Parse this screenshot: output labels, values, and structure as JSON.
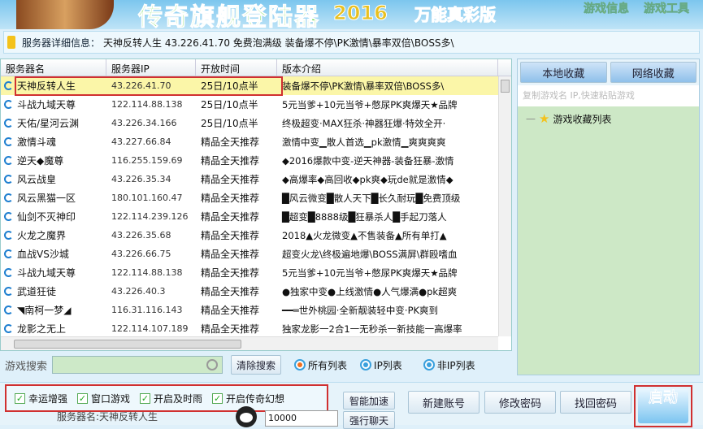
{
  "header": {
    "title": "传奇旗舰登陆器",
    "year": "2016",
    "edition": "万能真彩版",
    "links": [
      "游戏信息",
      "游戏工具"
    ]
  },
  "info": {
    "label": "服务器详细信息：",
    "value": "天神反转人生 43.226.41.70 免费泡满级 装备爆不停\\PK激情\\暴率双倍\\BOSS多\\"
  },
  "table": {
    "columns": [
      "服务器名",
      "服务器IP",
      "开放时间",
      "版本介绍"
    ],
    "rows": [
      {
        "name": "天神反转人生",
        "ip": "43.226.41.70",
        "time": "25日/10点半",
        "desc": "装备爆不停\\PK激情\\暴率双倍\\BOSS多\\",
        "selected": true
      },
      {
        "name": "斗战九域天尊",
        "ip": "122.114.88.138",
        "time": "25日/10点半",
        "desc": "5元当爹+10元当爷+憋尿PK爽爆天★品牌"
      },
      {
        "name": "天佑/星河云渊",
        "ip": "43.226.34.166",
        "time": "25日/10点半",
        "desc": "终极超变·MAX狂杀·神器狂爆·特效全开·"
      },
      {
        "name": "激情斗魂",
        "ip": "43.227.66.84",
        "time": "精品全天推荐",
        "desc": "激情中变▁散人首选▁pk激情▁爽爽爽爽"
      },
      {
        "name": "逆天◆魔尊",
        "ip": "116.255.159.69",
        "time": "精品全天推荐",
        "desc": "◆2016爆款中变-逆天神器-装备狂暴-激情"
      },
      {
        "name": "风云战皇",
        "ip": "43.226.35.34",
        "time": "精品全天推荐",
        "desc": "◆高爆率◆高回收◆pk爽◆玩de就是激情◆"
      },
      {
        "name": "风云黑猫一区",
        "ip": "180.101.160.47",
        "time": "精品全天推荐",
        "desc": "█风云微变█散人天下█长久耐玩█免费顶级"
      },
      {
        "name": "仙剑不灭神印",
        "ip": "122.114.239.126",
        "time": "精品全天推荐",
        "desc": "█超变█8888级█狂暴杀人█手起刀落人"
      },
      {
        "name": "火龙之魔界",
        "ip": "43.226.35.68",
        "time": "精品全天推荐",
        "desc": "2018▲火龙微变▲不售装备▲所有单打▲"
      },
      {
        "name": "血战VS沙城",
        "ip": "43.226.66.75",
        "time": "精品全天推荐",
        "desc": "超变火龙\\终极遍地爆\\BOSS满屏\\群殴嗜血"
      },
      {
        "name": "斗战九域天尊",
        "ip": "122.114.88.138",
        "time": "精品全天推荐",
        "desc": "5元当爹+10元当爷+憋尿PK爽爆天★品牌"
      },
      {
        "name": "武道狂徒",
        "ip": "43.226.40.3",
        "time": "精品全天推荐",
        "desc": "●独家中变●上线激情●人气爆满●pk超爽"
      },
      {
        "name": "◥南柯一梦◢",
        "ip": "116.31.116.143",
        "time": "精品全天推荐",
        "desc": "━━═世外桃园·全新靓装轻中变·PK爽到"
      },
      {
        "name": "龙影之无上",
        "ip": "122.114.107.189",
        "time": "精品全天推荐",
        "desc": "独家龙影一2合1一无秒杀一新技能一高爆率"
      }
    ]
  },
  "search": {
    "label": "游戏搜索",
    "value": "",
    "clear": "清除搜索",
    "radios": [
      {
        "label": "所有列表",
        "checked": true
      },
      {
        "label": "IP列表",
        "checked": false
      },
      {
        "label": "非IP列表",
        "checked": false
      }
    ]
  },
  "favorites": {
    "tabs": [
      "本地收藏",
      "网络收藏"
    ],
    "placeholder": "复制游戏名 IP,快速粘贴游戏",
    "tree_root": "游戏收藏列表"
  },
  "options": {
    "checkboxes": [
      {
        "label": "幸运增强",
        "checked": true
      },
      {
        "label": "窗口游戏",
        "checked": true
      },
      {
        "label": "开启及时雨",
        "checked": true
      },
      {
        "label": "开启传奇幻想",
        "checked": true
      }
    ],
    "server_name": "服务器名:天神反转人生",
    "qq": "10000"
  },
  "actions": {
    "accelerate": "智能加速",
    "chat": "强行聊天",
    "new_account": "新建账号",
    "change_password": "修改密码",
    "recover_password": "找回密码",
    "start": "启动"
  },
  "colors": {
    "highlight": "#d03030",
    "selected_row": "#fbf6a8",
    "favorites_bg": "#cde8c6"
  }
}
